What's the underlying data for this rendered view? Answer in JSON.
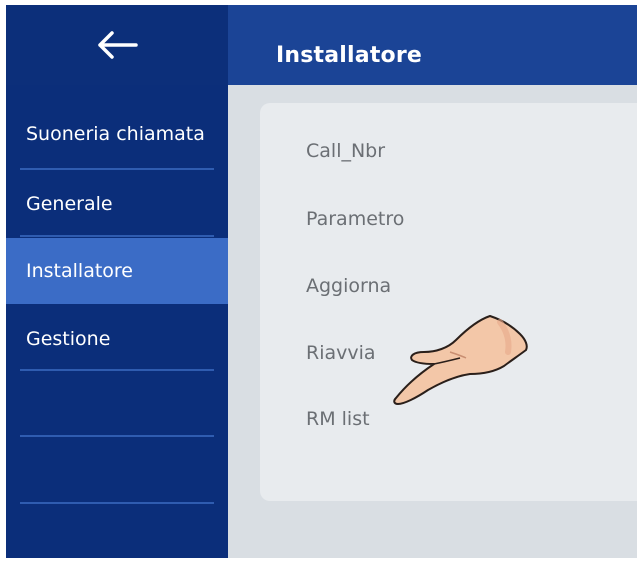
{
  "header": {
    "back_icon": "arrow-left-icon",
    "title": "Installatore"
  },
  "sidebar": {
    "items": [
      {
        "label": "Suoneria chiamata",
        "active": false
      },
      {
        "label": "Generale",
        "active": false
      },
      {
        "label": "Installatore",
        "active": true
      },
      {
        "label": "Gestione",
        "active": false
      }
    ]
  },
  "main": {
    "items": [
      {
        "label": "Call_Nbr"
      },
      {
        "label": "Parametro"
      },
      {
        "label": "Aggiorna"
      },
      {
        "label": "Riavvia"
      },
      {
        "label": "RM list"
      }
    ]
  },
  "colors": {
    "header_bg": "#1b4496",
    "sidebar_bg": "#0b2e7a",
    "sidebar_active": "#3b6cc6",
    "content_bg": "#d9dee3",
    "card_bg": "#e8ebee",
    "item_text": "#6b6f74"
  }
}
